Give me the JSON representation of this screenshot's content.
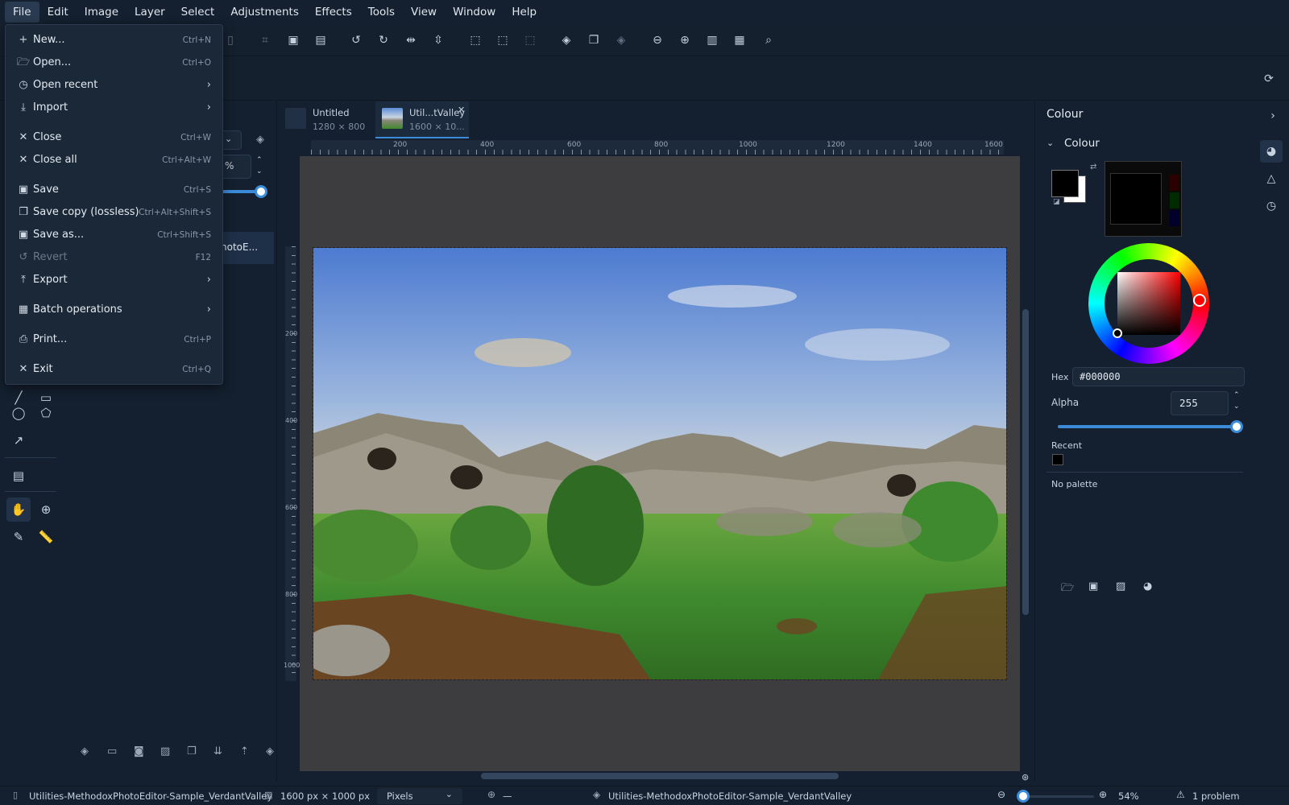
{
  "menubar": {
    "items": [
      "File",
      "Edit",
      "Image",
      "Layer",
      "Select",
      "Adjustments",
      "Effects",
      "Tools",
      "View",
      "Window",
      "Help"
    ]
  },
  "file_menu": {
    "items": [
      {
        "icon": "plus-icon",
        "label": "New...",
        "shortcut": "Ctrl+N"
      },
      {
        "icon": "folder-open-icon",
        "label": "Open...",
        "shortcut": "Ctrl+O"
      },
      {
        "icon": "clock-icon",
        "label": "Open recent",
        "submenu": true
      },
      {
        "icon": "download-icon",
        "label": "Import",
        "submenu": true
      },
      {
        "icon": "close-icon",
        "label": "Close",
        "shortcut": "Ctrl+W"
      },
      {
        "icon": "close-icon",
        "label": "Close all",
        "shortcut": "Ctrl+Alt+W"
      },
      {
        "icon": "save-icon",
        "label": "Save",
        "shortcut": "Ctrl+S"
      },
      {
        "icon": "copy-icon",
        "label": "Save copy (lossless)",
        "shortcut": "Ctrl+Alt+Shift+S"
      },
      {
        "icon": "save-as-icon",
        "label": "Save as...",
        "shortcut": "Ctrl+Shift+S"
      },
      {
        "icon": "revert-icon",
        "label": "Revert",
        "shortcut": "F12",
        "disabled": true
      },
      {
        "icon": "upload-icon",
        "label": "Export",
        "submenu": true
      },
      {
        "icon": "batch-icon",
        "label": "Batch operations",
        "submenu": true
      },
      {
        "icon": "printer-icon",
        "label": "Print...",
        "shortcut": "Ctrl+P"
      },
      {
        "icon": "close-icon",
        "label": "Exit",
        "shortcut": "Ctrl+Q"
      }
    ]
  },
  "layers_panel": {
    "opacity_unit": "%",
    "layer_name_fragment": "hotoE..."
  },
  "doc_tabs": [
    {
      "name": "Untitled",
      "size": "1280 × 800",
      "active": false
    },
    {
      "name": "Util...tValley",
      "size": "1600 × 10...",
      "active": true
    }
  ],
  "rulers": {
    "h_ticks": [
      "200",
      "400",
      "600",
      "800",
      "1000",
      "1200",
      "1400",
      "1600"
    ],
    "v_ticks": [
      "200",
      "400",
      "600",
      "800",
      "1000"
    ]
  },
  "colour_panel": {
    "title": "Colour",
    "section": "Colour",
    "hex_label": "Hex",
    "hex_value": "#000000",
    "alpha_label": "Alpha",
    "alpha_value": "255",
    "recent_label": "Recent",
    "palette_text": "No palette",
    "primary_color": "#000000",
    "secondary_color": "#ffffff"
  },
  "statusbar": {
    "file_name": "Utilities-MethodoxPhotoEditor-Sample_VerdantValley",
    "image_size": "1600 px × 1000 px",
    "unit": "Pixels",
    "cursor_pos": "—",
    "layer_name": "Utilities-MethodoxPhotoEditor-Sample_VerdantValley",
    "zoom": "54%",
    "problems": "1 problem"
  }
}
